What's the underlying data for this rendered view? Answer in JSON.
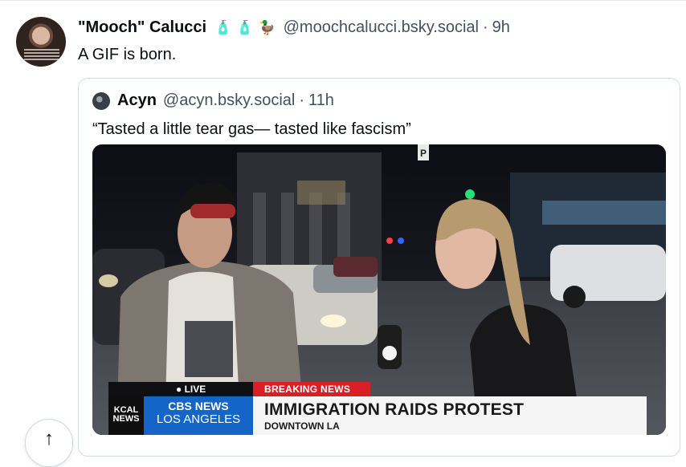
{
  "post": {
    "author_display_name": "\"Mooch\" Calucci",
    "author_emojis": [
      {
        "icon": "bottle-icon",
        "glyph": "🧴"
      },
      {
        "icon": "bottle-icon",
        "glyph": "🧴"
      },
      {
        "icon": "duck-icon",
        "glyph": "🦆"
      }
    ],
    "author_handle": "@moochcalucci.bsky.social",
    "separator": "·",
    "time": "9h",
    "text": "A GIF is born."
  },
  "quoted_post": {
    "author_display_name": "Acyn",
    "author_handle": "@acyn.bsky.social",
    "separator": "·",
    "time": "11h",
    "text": "“Tasted a little tear gas— tasted like fascism”"
  },
  "video_overlay": {
    "live_label": "LIVE",
    "breaking_label": "BREAKING NEWS",
    "station_logo": "KCAL NEWS",
    "network_line1": "CBS NEWS",
    "network_line2": "LOS ANGELES",
    "headline": "IMMIGRATION RAIDS PROTEST",
    "subheadline": "DOWNTOWN LA",
    "corner_sign": "P"
  },
  "controls": {
    "scroll_top_icon": "arrow-up-icon",
    "scroll_top_glyph": "↑"
  },
  "colors": {
    "accent_link": "#44505e",
    "breaking_red": "#d81f26",
    "cbs_blue": "#1565c8"
  }
}
